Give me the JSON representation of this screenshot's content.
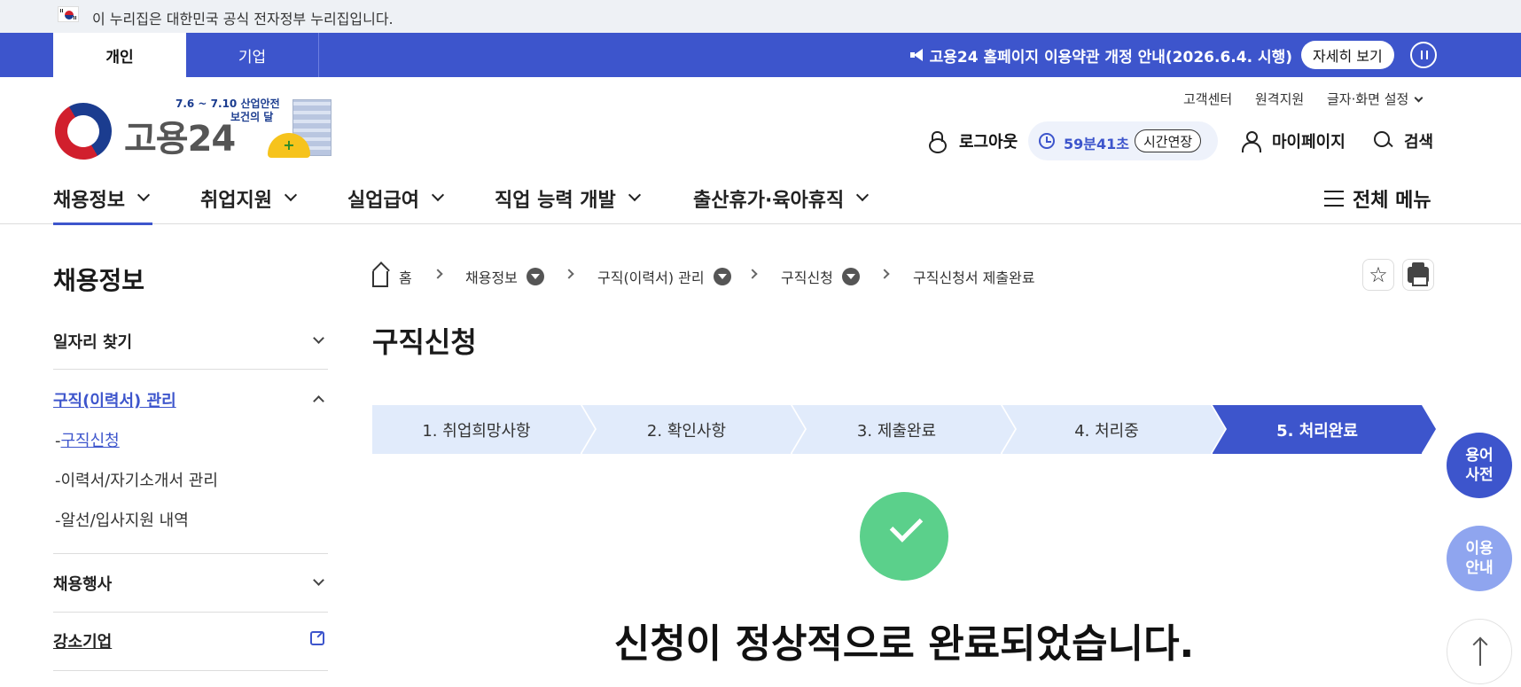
{
  "gov_banner": {
    "text": "이 누리집은 대한민국 공식 전자정부 누리집입니다."
  },
  "topbar": {
    "tabs": [
      {
        "label": "개인"
      },
      {
        "label": "기업"
      }
    ],
    "notice": "고용24 홈페이지 이용약관 개정 안내(2026.6.4. 시행)",
    "detail_label": "자세히 보기"
  },
  "header": {
    "logo_text": "고용24",
    "badge_line1": "7.6 ~ 7.10  산업안전",
    "badge_line2": "보건의 달",
    "util_links": [
      "고객센터",
      "원격지원",
      "글자·화면 설정"
    ],
    "logout_label": "로그아웃",
    "timer": "59분41초",
    "extend_label": "시간연장",
    "mypage_label": "마이페이지",
    "search_label": "검색"
  },
  "gnb": {
    "items": [
      "채용정보",
      "취업지원",
      "실업급여",
      "직업 능력 개발",
      "출산휴가·육아휴직"
    ],
    "all_menu": "전체 메뉴"
  },
  "side": {
    "title": "채용정보",
    "items": [
      "일자리 찾기",
      "구직(이력서) 관리",
      "채용행사",
      "강소기업"
    ],
    "sub_items": [
      "구직신청",
      "이력서/자기소개서 관리",
      "알선/입사지원 내역"
    ]
  },
  "breadcrumb": [
    "홈",
    "채용정보",
    "구직(이력서) 관리",
    "구직신청",
    "구직신청서 제출완료"
  ],
  "page": {
    "title": "구직신청"
  },
  "steps": [
    "1. 취업희망사항",
    "2. 확인사항",
    "3. 제출완료",
    "4. 처리중",
    "5. 처리완료"
  ],
  "completion": {
    "message": "신청이 정상적으로 완료되었습니다."
  },
  "floating": [
    "용어\n사전",
    "이용\n안내"
  ],
  "colors": {
    "brand": "#3d55cc",
    "step_bg": "#e1ebfb",
    "success": "#5bd08b"
  }
}
